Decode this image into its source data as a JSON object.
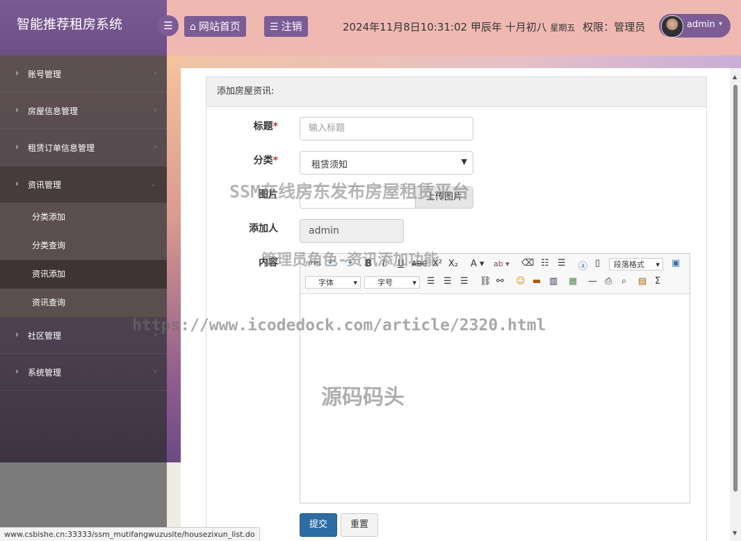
{
  "app": {
    "title": "智能推荐租房系统"
  },
  "topbar": {
    "home_label": "网站首页",
    "logout_label": "注销",
    "datetime": "2024年11月8日10:31:02 甲辰年 十月初八",
    "weekday": "星期五",
    "role_text": "权限：管理员",
    "user": "admin"
  },
  "sidebar": {
    "items": [
      {
        "label": "账号管理"
      },
      {
        "label": "房屋信息管理"
      },
      {
        "label": "租赁订单信息管理"
      },
      {
        "label": "资讯管理",
        "open": true
      }
    ],
    "sub_items": [
      {
        "label": "分类添加"
      },
      {
        "label": "分类查询"
      },
      {
        "label": "资讯添加",
        "active": true
      },
      {
        "label": "资讯查询"
      }
    ],
    "items_after": [
      {
        "label": "社区管理"
      },
      {
        "label": "系统管理"
      }
    ]
  },
  "panel": {
    "title": "添加房屋资讯:"
  },
  "form": {
    "title_label": "标题",
    "title_placeholder": "输入标题",
    "category_label": "分类",
    "category_value": "租赁须知",
    "image_label": "图片",
    "upload_label": "上传图片",
    "author_label": "添加人",
    "author_value": "admin",
    "content_label": "内容",
    "editor": {
      "paragraph_select": "段落格式",
      "font_select": "字体",
      "size_select": "字号"
    },
    "submit_label": "提交",
    "reset_label": "重置"
  },
  "status_url": "www.csbishe.cn:33333/ssm_mutifangwuzusite/housezixun_list.do",
  "watermarks": {
    "line1": "SSM在线房东发布房屋租赁平台",
    "line2": "管理员角色-资讯添加功能",
    "line3": "https://www.icodedock.com/article/2320.html",
    "line4": "源码码头"
  },
  "colors": {
    "accent": "#7c5c95",
    "topbar": "#efb9b2",
    "primary_button": "#2e6da4"
  }
}
